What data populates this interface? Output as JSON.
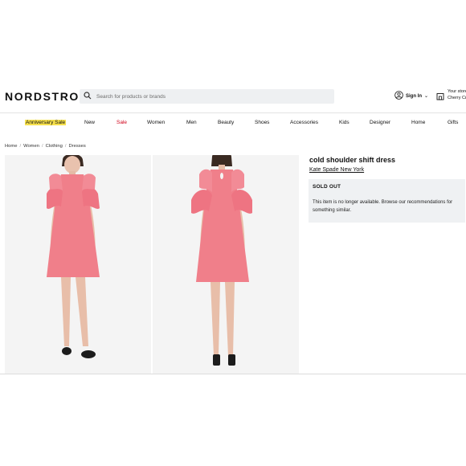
{
  "header": {
    "logo": "NORDSTROM",
    "search_placeholder": "Search for products or brands",
    "sign_in_label": "Sign In",
    "store_line1": "Your store",
    "store_line2": "Cherry Cr"
  },
  "nav": {
    "items": [
      "Anniversary Sale",
      "New",
      "Sale",
      "Women",
      "Men",
      "Beauty",
      "Shoes",
      "Accessories",
      "Kids",
      "Designer",
      "Home",
      "Gifts"
    ]
  },
  "breadcrumb": [
    "Home",
    "Women",
    "Clothing",
    "Dresses"
  ],
  "product": {
    "title": "cold shoulder shift dress",
    "brand": "Kate Spade New York",
    "status": "SOLD OUT",
    "message": "This item is no longer available. Browse our recommendations for something similar."
  },
  "colors": {
    "dress": "#f07f8a",
    "highlight": "#f7e14d",
    "sale": "#d0021b",
    "panel": "#eff1f3"
  },
  "icons": [
    "search-icon",
    "user-icon",
    "chevron-down-icon",
    "store-icon"
  ]
}
